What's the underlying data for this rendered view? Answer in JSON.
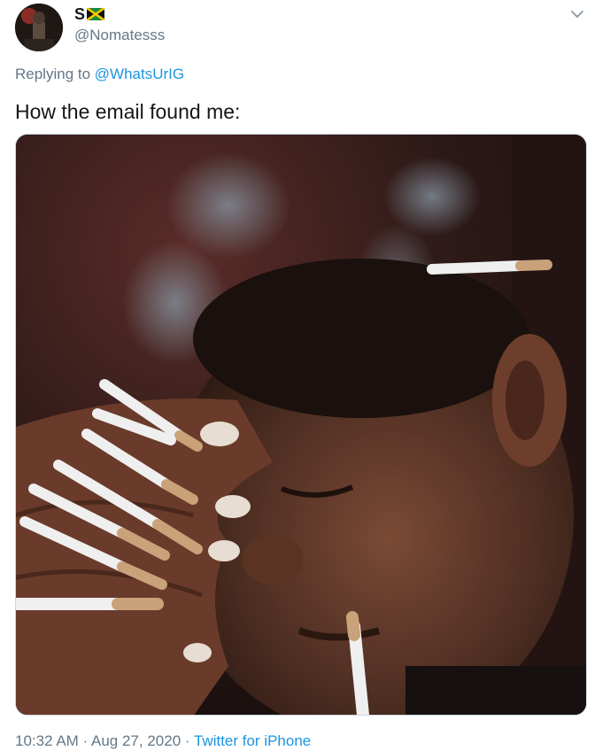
{
  "author": {
    "display_name": "S",
    "flag_icon": "jamaica-flag-icon",
    "handle": "@Nomatesss"
  },
  "reply": {
    "prefix": "Replying to",
    "mention": "@WhatsUrIG"
  },
  "tweet": {
    "text": "How the email found me:"
  },
  "media": {
    "icon": "photo-image"
  },
  "meta": {
    "time": "10:32 AM",
    "separator": " · ",
    "date": "Aug 27, 2020",
    "source": "Twitter for iPhone"
  },
  "colors": {
    "link": "#1b95e0",
    "secondary_text": "#657786",
    "primary_text": "#14171a"
  }
}
